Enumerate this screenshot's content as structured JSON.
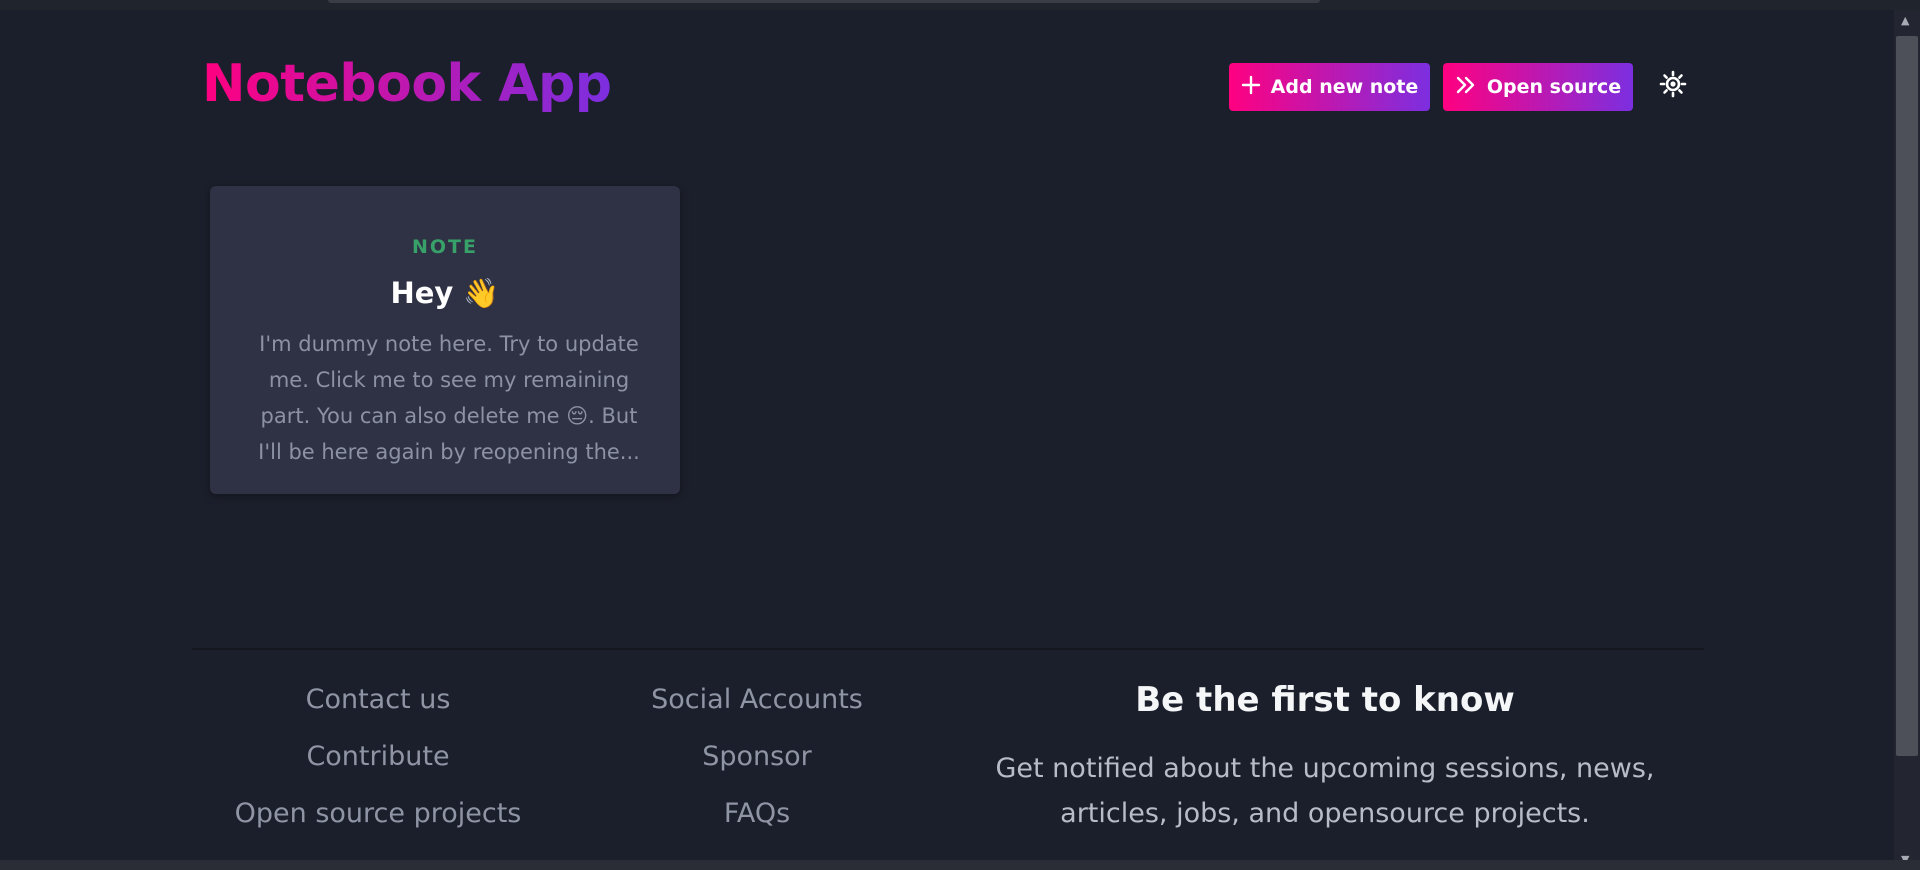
{
  "app": {
    "title": "Notebook App"
  },
  "header": {
    "add_note_label": "Add new note",
    "open_source_label": "Open source",
    "theme_icon": "sun-icon"
  },
  "notes": [
    {
      "tag": "NOTE",
      "title": "Hey 👋",
      "body": "I'm dummy note here. Try to update me. Click me to see my remaining part. You can also delete me 😔. But I'll be here again by reopening the..."
    }
  ],
  "footer": {
    "col1": [
      "Contact us",
      "Contribute",
      "Open source projects"
    ],
    "col2": [
      "Social Accounts",
      "Sponsor",
      "FAQs"
    ],
    "newsletter": {
      "heading": "Be the first to know",
      "text": "Get notified about the upcoming sessions, news, articles, jobs, and opensource projects."
    }
  },
  "colors": {
    "background": "#1b1f2b",
    "card": "#2f3244",
    "accent_gradient_start": "#ff0080",
    "accent_gradient_end": "#7c2fe0",
    "tag": "#38a169"
  }
}
